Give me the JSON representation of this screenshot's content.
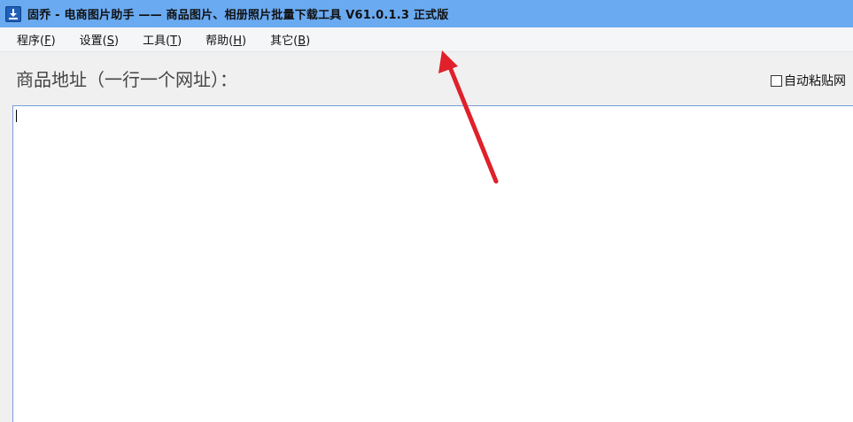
{
  "window": {
    "title": "固乔 - 电商图片助手 —— 商品图片、相册照片批量下载工具 V61.0.1.3 正式版",
    "icon": "download-app-icon"
  },
  "menu": {
    "items": [
      {
        "label": "程序(",
        "key": "F",
        "end": ")"
      },
      {
        "label": "设置(",
        "key": "S",
        "end": ")"
      },
      {
        "label": "工具(",
        "key": "T",
        "end": ")"
      },
      {
        "label": "帮助(",
        "key": "H",
        "end": ")"
      },
      {
        "label": "其它(",
        "key": "B",
        "end": ")"
      }
    ]
  },
  "main": {
    "url_label": "商品地址（一行一个网址）：",
    "auto_paste_label": "自动粘贴网",
    "auto_paste_checked": false,
    "url_input_value": ""
  },
  "colors": {
    "titlebar": "#6aaaf1",
    "annotation_arrow": "#e0202a"
  }
}
